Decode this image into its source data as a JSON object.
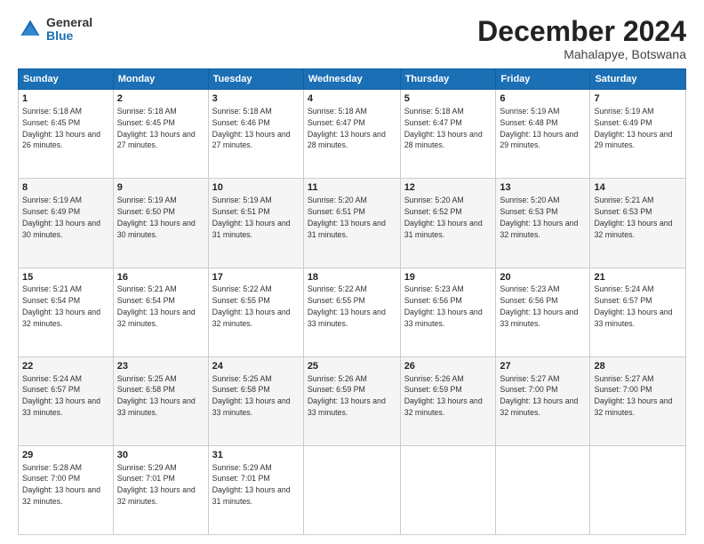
{
  "header": {
    "logo_general": "General",
    "logo_blue": "Blue",
    "month_title": "December 2024",
    "location": "Mahalapye, Botswana"
  },
  "days_of_week": [
    "Sunday",
    "Monday",
    "Tuesday",
    "Wednesday",
    "Thursday",
    "Friday",
    "Saturday"
  ],
  "weeks": [
    [
      {
        "day": "1",
        "sunrise": "5:18 AM",
        "sunset": "6:45 PM",
        "daylight": "13 hours and 26 minutes."
      },
      {
        "day": "2",
        "sunrise": "5:18 AM",
        "sunset": "6:45 PM",
        "daylight": "13 hours and 27 minutes."
      },
      {
        "day": "3",
        "sunrise": "5:18 AM",
        "sunset": "6:46 PM",
        "daylight": "13 hours and 27 minutes."
      },
      {
        "day": "4",
        "sunrise": "5:18 AM",
        "sunset": "6:47 PM",
        "daylight": "13 hours and 28 minutes."
      },
      {
        "day": "5",
        "sunrise": "5:18 AM",
        "sunset": "6:47 PM",
        "daylight": "13 hours and 28 minutes."
      },
      {
        "day": "6",
        "sunrise": "5:19 AM",
        "sunset": "6:48 PM",
        "daylight": "13 hours and 29 minutes."
      },
      {
        "day": "7",
        "sunrise": "5:19 AM",
        "sunset": "6:49 PM",
        "daylight": "13 hours and 29 minutes."
      }
    ],
    [
      {
        "day": "8",
        "sunrise": "5:19 AM",
        "sunset": "6:49 PM",
        "daylight": "13 hours and 30 minutes."
      },
      {
        "day": "9",
        "sunrise": "5:19 AM",
        "sunset": "6:50 PM",
        "daylight": "13 hours and 30 minutes."
      },
      {
        "day": "10",
        "sunrise": "5:19 AM",
        "sunset": "6:51 PM",
        "daylight": "13 hours and 31 minutes."
      },
      {
        "day": "11",
        "sunrise": "5:20 AM",
        "sunset": "6:51 PM",
        "daylight": "13 hours and 31 minutes."
      },
      {
        "day": "12",
        "sunrise": "5:20 AM",
        "sunset": "6:52 PM",
        "daylight": "13 hours and 31 minutes."
      },
      {
        "day": "13",
        "sunrise": "5:20 AM",
        "sunset": "6:53 PM",
        "daylight": "13 hours and 32 minutes."
      },
      {
        "day": "14",
        "sunrise": "5:21 AM",
        "sunset": "6:53 PM",
        "daylight": "13 hours and 32 minutes."
      }
    ],
    [
      {
        "day": "15",
        "sunrise": "5:21 AM",
        "sunset": "6:54 PM",
        "daylight": "13 hours and 32 minutes."
      },
      {
        "day": "16",
        "sunrise": "5:21 AM",
        "sunset": "6:54 PM",
        "daylight": "13 hours and 32 minutes."
      },
      {
        "day": "17",
        "sunrise": "5:22 AM",
        "sunset": "6:55 PM",
        "daylight": "13 hours and 32 minutes."
      },
      {
        "day": "18",
        "sunrise": "5:22 AM",
        "sunset": "6:55 PM",
        "daylight": "13 hours and 33 minutes."
      },
      {
        "day": "19",
        "sunrise": "5:23 AM",
        "sunset": "6:56 PM",
        "daylight": "13 hours and 33 minutes."
      },
      {
        "day": "20",
        "sunrise": "5:23 AM",
        "sunset": "6:56 PM",
        "daylight": "13 hours and 33 minutes."
      },
      {
        "day": "21",
        "sunrise": "5:24 AM",
        "sunset": "6:57 PM",
        "daylight": "13 hours and 33 minutes."
      }
    ],
    [
      {
        "day": "22",
        "sunrise": "5:24 AM",
        "sunset": "6:57 PM",
        "daylight": "13 hours and 33 minutes."
      },
      {
        "day": "23",
        "sunrise": "5:25 AM",
        "sunset": "6:58 PM",
        "daylight": "13 hours and 33 minutes."
      },
      {
        "day": "24",
        "sunrise": "5:25 AM",
        "sunset": "6:58 PM",
        "daylight": "13 hours and 33 minutes."
      },
      {
        "day": "25",
        "sunrise": "5:26 AM",
        "sunset": "6:59 PM",
        "daylight": "13 hours and 33 minutes."
      },
      {
        "day": "26",
        "sunrise": "5:26 AM",
        "sunset": "6:59 PM",
        "daylight": "13 hours and 32 minutes."
      },
      {
        "day": "27",
        "sunrise": "5:27 AM",
        "sunset": "7:00 PM",
        "daylight": "13 hours and 32 minutes."
      },
      {
        "day": "28",
        "sunrise": "5:27 AM",
        "sunset": "7:00 PM",
        "daylight": "13 hours and 32 minutes."
      }
    ],
    [
      {
        "day": "29",
        "sunrise": "5:28 AM",
        "sunset": "7:00 PM",
        "daylight": "13 hours and 32 minutes."
      },
      {
        "day": "30",
        "sunrise": "5:29 AM",
        "sunset": "7:01 PM",
        "daylight": "13 hours and 32 minutes."
      },
      {
        "day": "31",
        "sunrise": "5:29 AM",
        "sunset": "7:01 PM",
        "daylight": "13 hours and 31 minutes."
      },
      null,
      null,
      null,
      null
    ]
  ],
  "labels": {
    "sunrise_prefix": "Sunrise: ",
    "sunset_prefix": "Sunset: ",
    "daylight_prefix": "Daylight: "
  }
}
